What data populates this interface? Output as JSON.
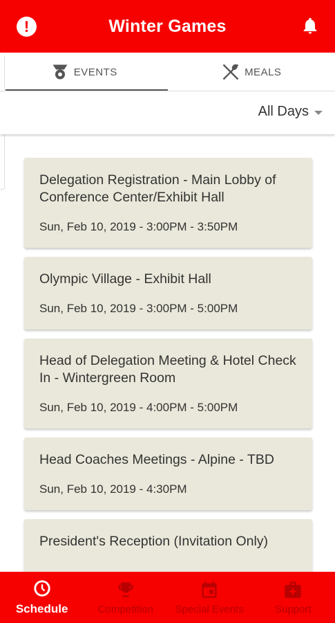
{
  "header": {
    "title": "Winter Games"
  },
  "tabs": [
    {
      "label": "EVENTS",
      "icon": "medal-icon",
      "active": true
    },
    {
      "label": "MEALS",
      "icon": "utensils-icon",
      "active": false
    }
  ],
  "filter": {
    "selected": "All Days"
  },
  "events": [
    {
      "name": "Delegation Registration - Main Lobby of Conference Center/Exhibit Hall",
      "when": "Sun, Feb 10, 2019 - 3:00PM - 3:50PM"
    },
    {
      "name": "Olympic Village - Exhibit Hall",
      "when": "Sun, Feb 10, 2019 - 3:00PM - 5:00PM"
    },
    {
      "name": "Head of Delegation Meeting & Hotel Check In - Wintergreen Room",
      "when": "Sun, Feb 10, 2019 - 4:00PM - 5:00PM"
    },
    {
      "name": "Head Coaches Meetings - Alpine - TBD",
      "when": "Sun, Feb 10, 2019 - 4:30PM"
    },
    {
      "name": "President's Reception (Invitation Only)",
      "when": ""
    }
  ],
  "bottom_nav": [
    {
      "label": "Schedule",
      "icon": "clock-icon",
      "active": true
    },
    {
      "label": "Competition",
      "icon": "trophy-icon",
      "active": false
    },
    {
      "label": "Special Events",
      "icon": "calendar-icon",
      "active": false
    },
    {
      "label": "Support",
      "icon": "first-aid-kit-icon",
      "active": false
    }
  ],
  "colors": {
    "primary": "#f60000",
    "card": "#eae8da",
    "inactive_nav": "#b80000"
  }
}
